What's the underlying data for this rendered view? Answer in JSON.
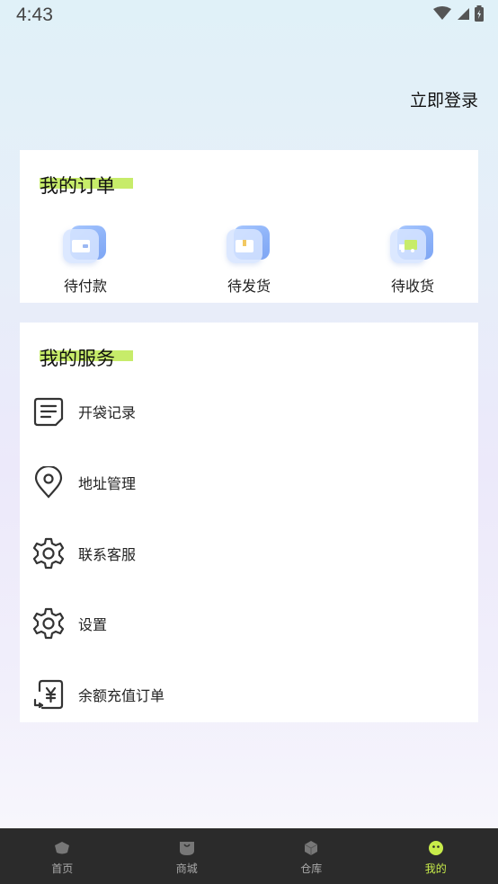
{
  "status_bar": {
    "time": "4:43"
  },
  "header": {
    "login_label": "立即登录"
  },
  "orders": {
    "title": "我的订单",
    "items": [
      {
        "label": "待付款",
        "icon": "wallet-icon"
      },
      {
        "label": "待发货",
        "icon": "package-icon"
      },
      {
        "label": "待收货",
        "icon": "truck-icon"
      }
    ]
  },
  "services": {
    "title": "我的服务",
    "items": [
      {
        "label": "开袋记录",
        "icon": "document-icon"
      },
      {
        "label": "地址管理",
        "icon": "location-pin-icon"
      },
      {
        "label": "联系客服",
        "icon": "gear-icon"
      },
      {
        "label": "设置",
        "icon": "gear-icon"
      },
      {
        "label": "余额充值订单",
        "icon": "yuan-receipt-icon"
      }
    ]
  },
  "bottom_nav": {
    "items": [
      {
        "label": "首页",
        "icon": "home-icon"
      },
      {
        "label": "商城",
        "icon": "shop-icon"
      },
      {
        "label": "仓库",
        "icon": "warehouse-icon"
      },
      {
        "label": "我的",
        "icon": "profile-icon",
        "active": true
      }
    ]
  },
  "colors": {
    "accent": "#c7ec6a",
    "nav_background": "#2b2b2b",
    "nav_active": "#c8ec4a"
  }
}
